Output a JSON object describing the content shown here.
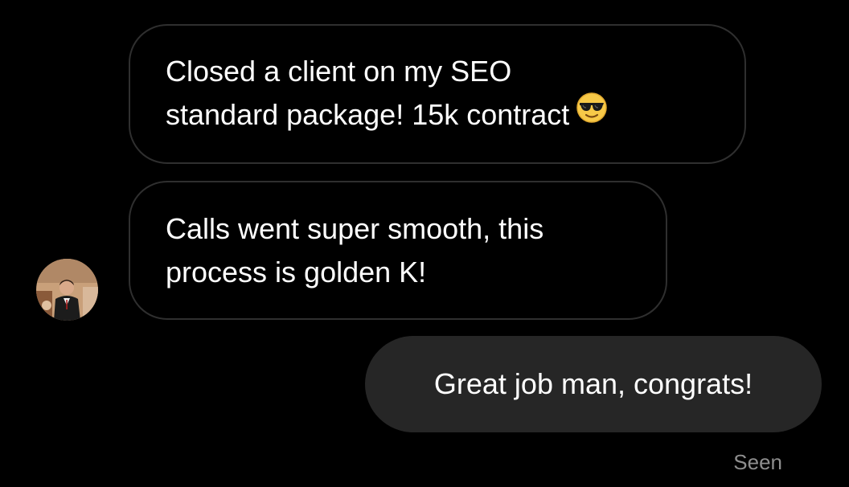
{
  "messages": [
    {
      "direction": "incoming",
      "text": "Closed a client on my SEO\nstandard package! 15k contract",
      "emoji": "smiling-face-with-sunglasses"
    },
    {
      "direction": "incoming",
      "text": "Calls went super smooth, this\nprocess is golden K!"
    },
    {
      "direction": "outgoing",
      "text": "Great job man, congrats!"
    }
  ],
  "status": {
    "seen_label": "Seen"
  },
  "colors": {
    "background": "#000000",
    "incoming_border": "#2f2f2f",
    "outgoing_fill": "#262626",
    "text": "#ffffff",
    "status_text": "#8e8e8e"
  }
}
